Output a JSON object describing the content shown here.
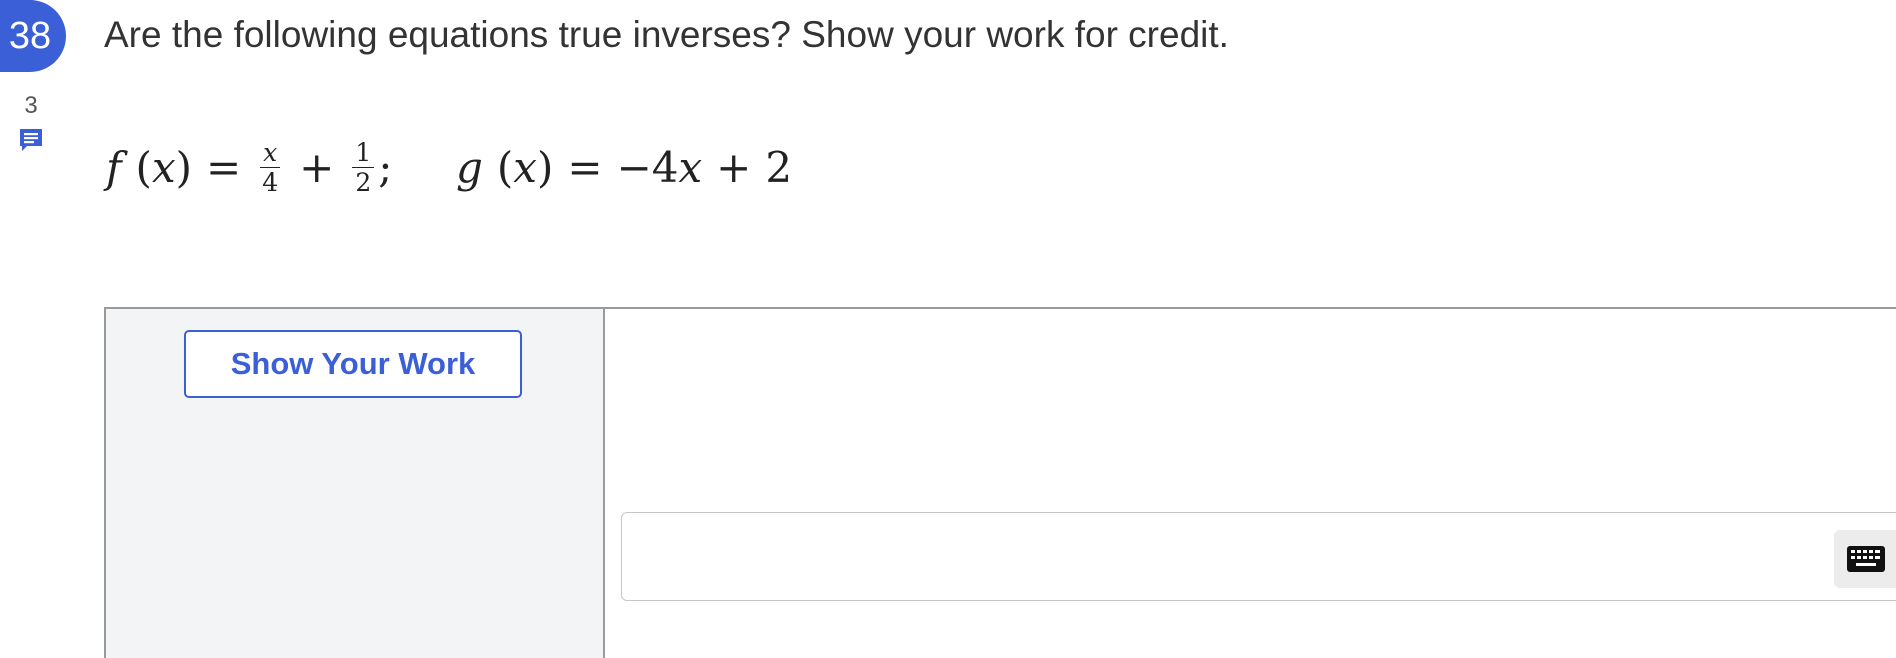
{
  "question": {
    "number": "38",
    "comment_count": "3",
    "prompt": "Are the following equations true inverses? Show your work for credit."
  },
  "equations": {
    "f": {
      "name": "f",
      "var": "x",
      "equals": "=",
      "frac1": {
        "num": "x",
        "den": "4"
      },
      "plus": "+",
      "frac2": {
        "num": "1",
        "den": "2"
      },
      "trail": ";"
    },
    "g": {
      "name": "g",
      "var": "x",
      "equals": "=",
      "coef": "−4",
      "x": "x",
      "plus": "+",
      "const": "2"
    }
  },
  "work_area": {
    "show_work_label": "Show Your Work",
    "answer_value": "",
    "answer_placeholder": ""
  },
  "icons": {
    "comment": "comment-icon",
    "keyboard": "keyboard-icon"
  },
  "colors": {
    "accent": "#3b5fd6",
    "panel_bg": "#f3f4f5"
  }
}
